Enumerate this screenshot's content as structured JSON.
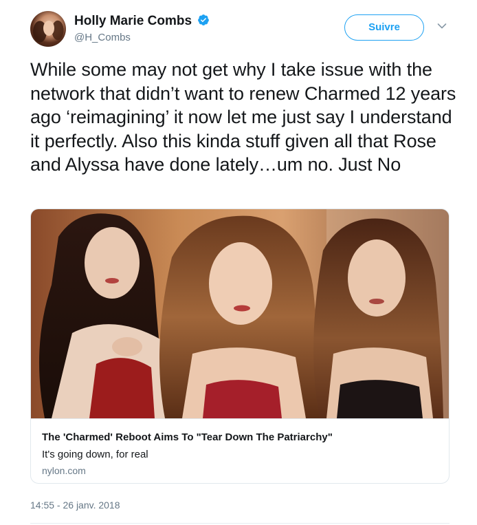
{
  "author": {
    "display_name": "Holly Marie Combs",
    "handle": "@H_Combs",
    "verified": true
  },
  "actions": {
    "follow_label": "Suivre"
  },
  "tweet": {
    "text": "While some may not get why I take issue with the network that didn’t want to renew Charmed 12 years ago ‘reimagining’ it now let me just say I understand it perfectly. Also this kinda stuff given all that Rose and Alyssa have done lately…um no. Just No",
    "timestamp": "14:55 - 26 janv. 2018"
  },
  "card": {
    "title": "The 'Charmed' Reboot Aims To \"Tear Down The Patriarchy\"",
    "description": "It's going down, for real",
    "domain": "nylon.com"
  },
  "colors": {
    "accent": "#1da1f2",
    "text": "#14171a",
    "muted": "#657786",
    "border": "#e1e8ed"
  },
  "icons": {
    "verified": "verified-badge-icon",
    "caret": "chevron-down-icon"
  }
}
